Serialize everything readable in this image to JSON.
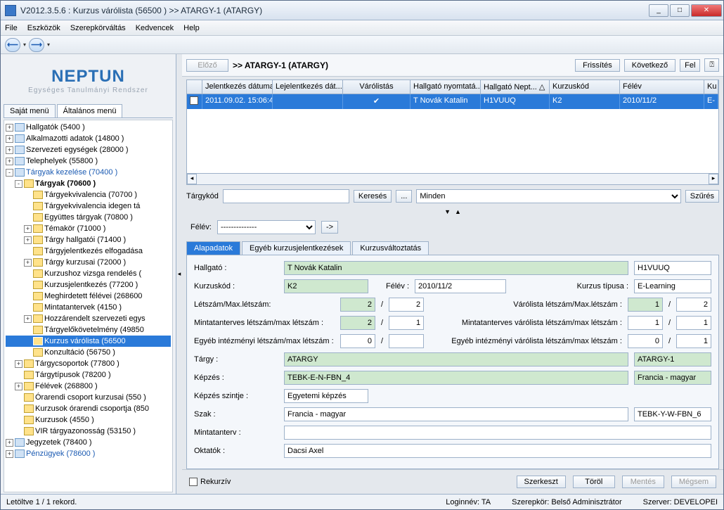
{
  "window": {
    "title": "V2012.3.5.6 : Kurzus várólista (56500  )  >> ATARGY-1 (ATARGY)"
  },
  "menubar": [
    "File",
    "Eszközök",
    "Szerepkörváltás",
    "Kedvencek",
    "Help"
  ],
  "logo": {
    "main": "NEPTUN",
    "sub": "Egységes Tanulmányi Rendszer"
  },
  "left_tabs": {
    "a": "Saját menü",
    "b": "Általános menü"
  },
  "tree": [
    {
      "ind": 0,
      "exp": "+",
      "ico": "diamond",
      "label": "Hallgatók (5400  )"
    },
    {
      "ind": 0,
      "exp": "+",
      "ico": "diamond",
      "label": "Alkalmazotti adatok (14800  )"
    },
    {
      "ind": 0,
      "exp": "+",
      "ico": "diamond",
      "label": "Szervezeti egységek (28000  )"
    },
    {
      "ind": 0,
      "exp": "+",
      "ico": "diamond",
      "label": "Telephelyek (55800  )"
    },
    {
      "ind": 0,
      "exp": "-",
      "ico": "diamond",
      "label": "Tárgyak kezelése (70400  )",
      "link": true
    },
    {
      "ind": 1,
      "exp": "-",
      "ico": "folder",
      "label": "Tárgyak (70600  )",
      "bold": true
    },
    {
      "ind": 2,
      "exp": "",
      "ico": "folder",
      "label": "Tárgyekvivalencia (70700  )"
    },
    {
      "ind": 2,
      "exp": "",
      "ico": "folder",
      "label": "Tárgyekvivalencia idegen tá"
    },
    {
      "ind": 2,
      "exp": "",
      "ico": "folder",
      "label": "Együttes tárgyak (70800  )"
    },
    {
      "ind": 2,
      "exp": "+",
      "ico": "folder",
      "label": "Témakör (71000  )"
    },
    {
      "ind": 2,
      "exp": "+",
      "ico": "folder",
      "label": "Tárgy hallgatói (71400  )"
    },
    {
      "ind": 2,
      "exp": "",
      "ico": "folder",
      "label": "Tárgyjelentkezés elfogadása"
    },
    {
      "ind": 2,
      "exp": "+",
      "ico": "folder",
      "label": "Tárgy kurzusai (72000  )"
    },
    {
      "ind": 2,
      "exp": "",
      "ico": "folder",
      "label": "Kurzushoz vizsga rendelés ("
    },
    {
      "ind": 2,
      "exp": "",
      "ico": "folder",
      "label": "Kurzusjelentkezés (77200  )"
    },
    {
      "ind": 2,
      "exp": "",
      "ico": "folder",
      "label": "Meghirdetett félévei (268600"
    },
    {
      "ind": 2,
      "exp": "",
      "ico": "folder",
      "label": "Mintatantervek (4150  )"
    },
    {
      "ind": 2,
      "exp": "+",
      "ico": "folder",
      "label": "Hozzárendelt szervezeti egys"
    },
    {
      "ind": 2,
      "exp": "",
      "ico": "folder",
      "label": "Tárgyelőkövetelmény (49850"
    },
    {
      "ind": 2,
      "exp": "",
      "ico": "folder",
      "label": "Kurzus várólista (56500",
      "selected": true
    },
    {
      "ind": 2,
      "exp": "",
      "ico": "folder",
      "label": "Konzultáció (56750  )"
    },
    {
      "ind": 1,
      "exp": "+",
      "ico": "folder",
      "label": "Tárgycsoportok (77800  )"
    },
    {
      "ind": 1,
      "exp": "",
      "ico": "folder",
      "label": "Tárgytípusok (78200  )"
    },
    {
      "ind": 1,
      "exp": "+",
      "ico": "folder",
      "label": "Félévek (268800  )"
    },
    {
      "ind": 1,
      "exp": "",
      "ico": "folder",
      "label": "Órarendi csoport kurzusai (550  )"
    },
    {
      "ind": 1,
      "exp": "",
      "ico": "folder",
      "label": "Kurzusok órarendi csoportja (850"
    },
    {
      "ind": 1,
      "exp": "",
      "ico": "folder",
      "label": "Kurzusok (4550  )"
    },
    {
      "ind": 1,
      "exp": "",
      "ico": "folder",
      "label": "VIR tárgyazonosság (53150  )"
    },
    {
      "ind": 0,
      "exp": "+",
      "ico": "diamond",
      "label": "Jegyzetek (78400  )"
    },
    {
      "ind": 0,
      "exp": "+",
      "ico": "diamond",
      "label": "Pénzügyek (78600  )",
      "link": true
    }
  ],
  "header": {
    "prev": "Előző",
    "title": ">> ATARGY-1 (ATARGY)",
    "refresh": "Frissítés",
    "next": "Következő",
    "up": "Fel"
  },
  "grid": {
    "cols": [
      "",
      "Jelentkezés dátuma",
      "Lejelentkezés dát...",
      "Várólistás",
      "Hallgató nyomtatá...",
      "Hallgató Nept...  △",
      "Kurzuskód",
      "Félév",
      "Ku"
    ],
    "row": [
      "",
      "2011.09.02. 15:06:4",
      "",
      "✔",
      "T Novák Katalin",
      "H1VUUQ",
      "K2",
      "2010/11/2",
      "E-"
    ]
  },
  "filter": {
    "targykod_lbl": "Tárgykód",
    "kereses": "Keresés",
    "dots": "...",
    "minden": "Minden",
    "szures": "Szűrés"
  },
  "felvrow": {
    "label": "Félév:",
    "value": "--------------",
    "arrow": "->"
  },
  "dtabs": [
    "Alapadatok",
    "Egyéb kurzusjelentkezések",
    "Kurzusváltoztatás"
  ],
  "detail": {
    "hallgato_lbl": "Hallgató :",
    "hallgato": "T Novák Katalin",
    "hallgato_code": "H1VUUQ",
    "kurzuskod_lbl": "Kurzuskód :",
    "kurzuskod": "K2",
    "felev_lbl": "Félév :",
    "felev": "2010/11/2",
    "kurz_tipus_lbl": "Kurzus típusa :",
    "kurz_tipus": "E-Learning",
    "letszam_lbl": "Létszám/Max.létszám:",
    "letszam_a": "2",
    "letszam_b": "2",
    "varo_lbl": "Várólista létszám/Max.létszám :",
    "varo_a": "1",
    "varo_b": "2",
    "minta_lbl": "Mintatanterves létszám/max létszám :",
    "minta_a": "2",
    "minta_b": "1",
    "mintav_lbl": "Mintatanterves várólista létszám/max létszám :",
    "mintav_a": "1",
    "mintav_b": "1",
    "egyeb_lbl": "Egyéb intézményi létszám/max létszám :",
    "egyeb_a": "0",
    "egyeb_b": "",
    "egyebv_lbl": "Egyéb intézményi várólista létszám/max létszám :",
    "egyebv_a": "0",
    "egyebv_b": "1",
    "targy_lbl": "Tárgy :",
    "targy": "ATARGY",
    "targy_code": "ATARGY-1",
    "kepzes_lbl": "Képzés :",
    "kepzes": "TEBK-E-N-FBN_4",
    "kepzes2": "Francia - magyar",
    "kepzes_szint_lbl": "Képzés szintje :",
    "kepzes_szint": "Egyetemi képzés",
    "szak_lbl": "Szak :",
    "szak": "Francia  - magyar",
    "szak_code": "TEBK-Y-W-FBN_6",
    "mintaterv_lbl": "Mintatanterv :",
    "mintaterv": "",
    "oktatok_lbl": "Oktatók :",
    "oktatok": "Dacsi Axel"
  },
  "footer": {
    "rekurziv": "Rekurzív",
    "szerkeszt": "Szerkeszt",
    "torol": "Töröl",
    "mentes": "Mentés",
    "megsem": "Mégsem"
  },
  "status": {
    "rec": "Letöltve 1 / 1 rekord.",
    "login": "Loginnév: TA",
    "role": "Szerepkör: Belső Adminisztrátor",
    "server": "Szerver: DEVELOPEI"
  }
}
